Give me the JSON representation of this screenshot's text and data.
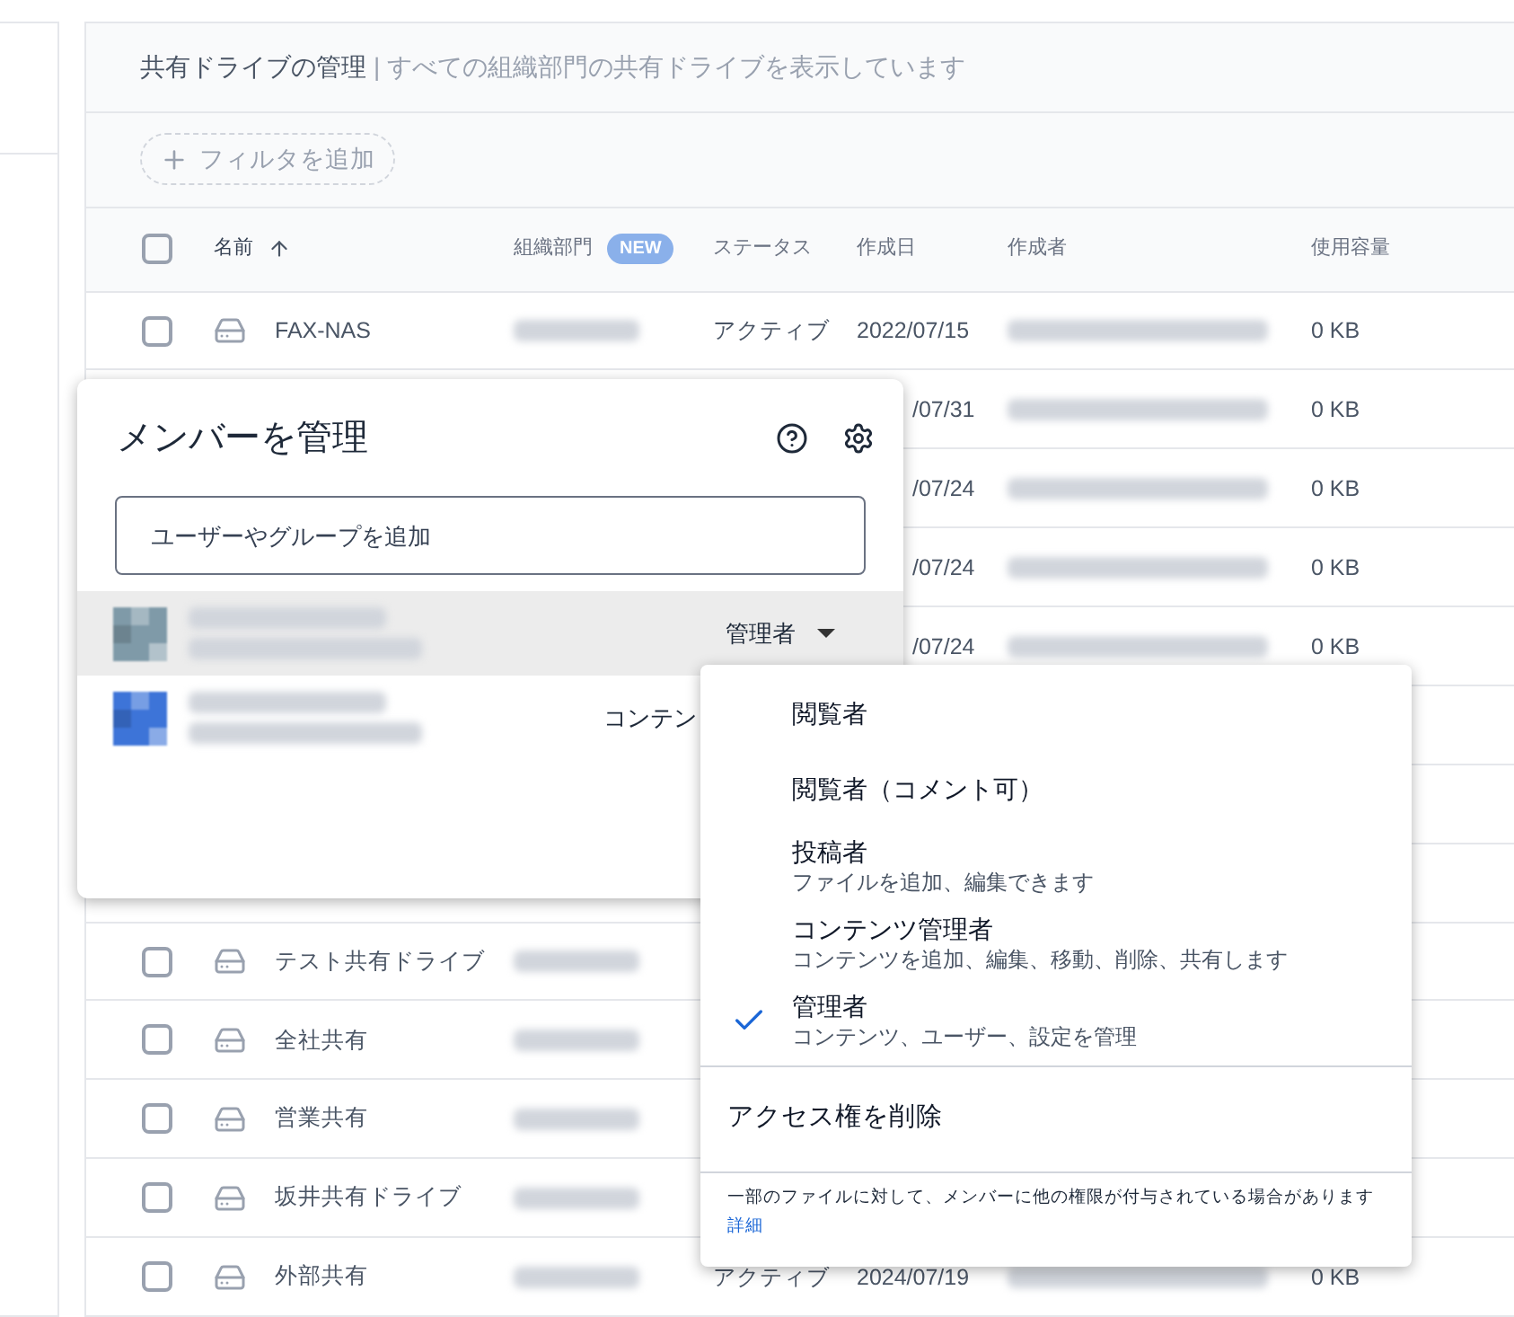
{
  "header": {
    "title": "共有ドライブの管理",
    "separator": "|",
    "subtitle": "すべての組織部門の共有ドライブを表示しています"
  },
  "filter_button": {
    "label": "フィルタを追加"
  },
  "table": {
    "select_all": {
      "checked": false
    },
    "columns": [
      {
        "label": "名前",
        "sorted": true
      },
      {
        "label": "組織部門",
        "badge": "NEW",
        "sorted": false
      },
      {
        "label": "ステータス",
        "sorted": false
      },
      {
        "label": "作成日",
        "sorted": false
      },
      {
        "label": "作成者",
        "sorted": false
      },
      {
        "label": "使用容量",
        "sorted": false
      }
    ],
    "rows": [
      {
        "kind": "full",
        "checked": false,
        "name": "FAX-NAS",
        "status": "アクティブ",
        "created": "2022/07/15",
        "size": "0 KB"
      },
      {
        "kind": "tail",
        "created": "/07/31",
        "size": "0 KB"
      },
      {
        "kind": "tail",
        "created": "/07/24",
        "size": "0 KB"
      },
      {
        "kind": "tail",
        "created": "/07/24",
        "size": "0 KB"
      },
      {
        "kind": "tail",
        "created": "/07/24",
        "size": "0 KB"
      },
      {
        "kind": "covered"
      },
      {
        "kind": "covered"
      },
      {
        "kind": "covered"
      },
      {
        "kind": "head",
        "checked": false,
        "name": "テスト共有ドライブ"
      },
      {
        "kind": "head",
        "checked": false,
        "name": "全社共有"
      },
      {
        "kind": "head",
        "checked": false,
        "name": "営業共有"
      },
      {
        "kind": "head",
        "checked": false,
        "name": "坂井共有ドライブ"
      },
      {
        "kind": "full",
        "checked": false,
        "name": "外部共有",
        "status": "アクティブ",
        "created": "2024/07/19",
        "size": "0 KB"
      }
    ]
  },
  "dialog": {
    "title": "メンバーを管理",
    "search": {
      "placeholder": "ユーザーやグループを追加"
    },
    "members": [
      {
        "role": "管理者",
        "selected": true,
        "color": "#7f9aa8"
      },
      {
        "role": "コンテン",
        "selected": false,
        "color": "#3d74d8"
      }
    ]
  },
  "role_menu": {
    "options": [
      {
        "label": "閲覧者",
        "selected": false
      },
      {
        "label": "閲覧者（コメント可）",
        "selected": false
      },
      {
        "label": "投稿者",
        "description": "ファイルを追加、編集できます",
        "selected": false
      },
      {
        "label": "コンテンツ管理者",
        "description": "コンテンツを追加、編集、移動、削除、共有します",
        "selected": false
      },
      {
        "label": "管理者",
        "description": "コンテンツ、ユーザー、設定を管理",
        "selected": true
      }
    ],
    "remove": "アクセス権を削除",
    "note": "一部のファイルに対して、メンバーに他の権限が付与されている場合があります",
    "link": "詳細"
  }
}
